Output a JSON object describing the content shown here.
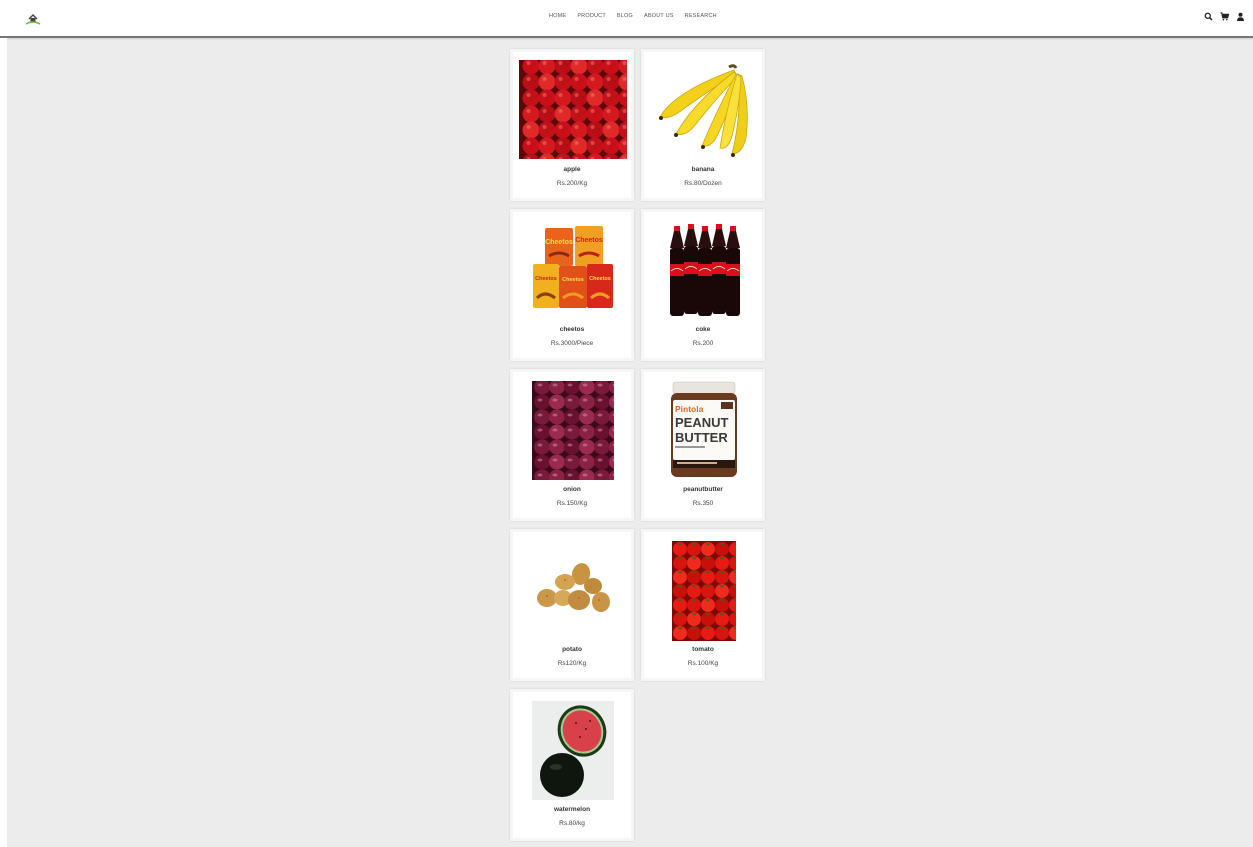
{
  "header": {
    "nav": [
      "HOME",
      "PRODUCT",
      "BLOG",
      "ABOUT US",
      "RESEARCH"
    ],
    "icons": [
      "search-icon",
      "cart-icon",
      "user-icon"
    ]
  },
  "colors": {
    "background": "#ececec",
    "card": "#ffffff",
    "brand_green": "#6db33f"
  },
  "products": [
    {
      "name": "apple",
      "price": "Rs.200/Kg",
      "image": "apples"
    },
    {
      "name": "banana",
      "price": "Rs.80/Dozen",
      "image": "bananas"
    },
    {
      "name": "cheetos",
      "price": "Rs.3000/Piece",
      "image": "cheetos-packs"
    },
    {
      "name": "coke",
      "price": "Rs.200",
      "image": "coke-bottles"
    },
    {
      "name": "onion",
      "price": "Rs.150/Kg",
      "image": "onions"
    },
    {
      "name": "peanutbutter",
      "price": "Rs.350",
      "image": "peanut-butter-jar"
    },
    {
      "name": "potato",
      "price": "Rs120/Kg",
      "image": "potatoes"
    },
    {
      "name": "tomato",
      "price": "Rs.100/Kg",
      "image": "tomatoes"
    },
    {
      "name": "watermelon",
      "price": "Rs.80/kg",
      "image": "watermelon"
    }
  ],
  "jar": {
    "brand": "Pintola",
    "line1": "PEANUT",
    "line2": "BUTTER"
  }
}
